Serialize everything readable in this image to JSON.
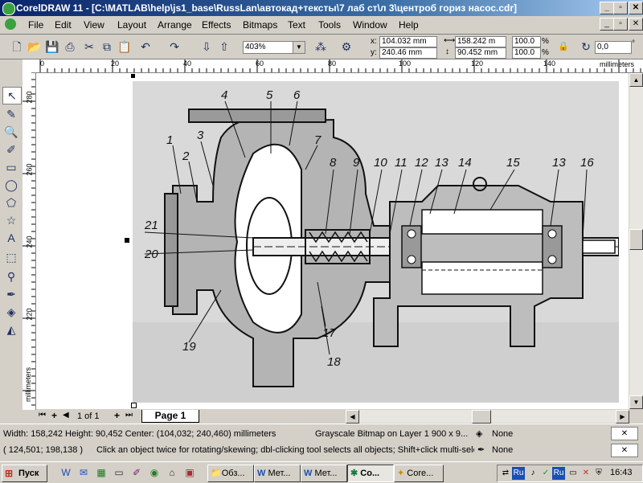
{
  "window": {
    "title": "CorelDRAW 11 - [C:\\MATLAB\\help\\js1_base\\RussLan\\автокад+тексты\\7 лаб ст\\л 3\\центроб гориз насос.cdr]",
    "controls": {
      "minimize": "_",
      "restore": "▫",
      "close": "✕"
    }
  },
  "menu": {
    "items": [
      "File",
      "Edit",
      "View",
      "Layout",
      "Arrange",
      "Effects",
      "Bitmaps",
      "Text",
      "Tools",
      "Window",
      "Help"
    ]
  },
  "toolbar": {
    "zoom": "403%",
    "x_label": "x:",
    "x_value": "104.032 mm",
    "y_label": "y:",
    "y_value": "240.46 mm",
    "w_value": "158.242 m",
    "h_value": "90.452 mm",
    "scale_x": "100.0",
    "scale_y": "100.0",
    "percent": "%",
    "angle": "0,0",
    "angle_unit": "°"
  },
  "ruler": {
    "h_labels": [
      "20",
      "40",
      "60",
      "80",
      "100",
      "120",
      "140"
    ],
    "h_zero": "0",
    "h_unit": "millimeters",
    "v_labels": [
      "280",
      "260",
      "240",
      "220"
    ],
    "v_unit": "millimeters"
  },
  "drawing": {
    "labels": [
      "1",
      "2",
      "3",
      "4",
      "5",
      "6",
      "7",
      "8",
      "9",
      "10",
      "11",
      "12",
      "13",
      "14",
      "15",
      "13",
      "16",
      "21",
      "20",
      "19",
      "17",
      "18"
    ]
  },
  "pagebar": {
    "page_count": "1 of 1",
    "page_tab": "Page 1"
  },
  "status": {
    "dims": "Width: 158,242  Height: 90,452  Center: (104,032; 240,460)  millimeters",
    "object": "Grayscale Bitmap on Layer 1 900 x 9...",
    "fill": "None",
    "coords": "( 124,501; 198,138 )",
    "hint": "Click an object twice for rotating/skewing; dbl-clicking tool selects all objects; Shift+click multi-sele...",
    "outline": "None"
  },
  "taskbar": {
    "start": "Пуск",
    "tasks": [
      "Обз...",
      "Мет...",
      "Мет...",
      "Co...",
      "Core..."
    ],
    "clock": "16:43",
    "lang": "Ru"
  }
}
